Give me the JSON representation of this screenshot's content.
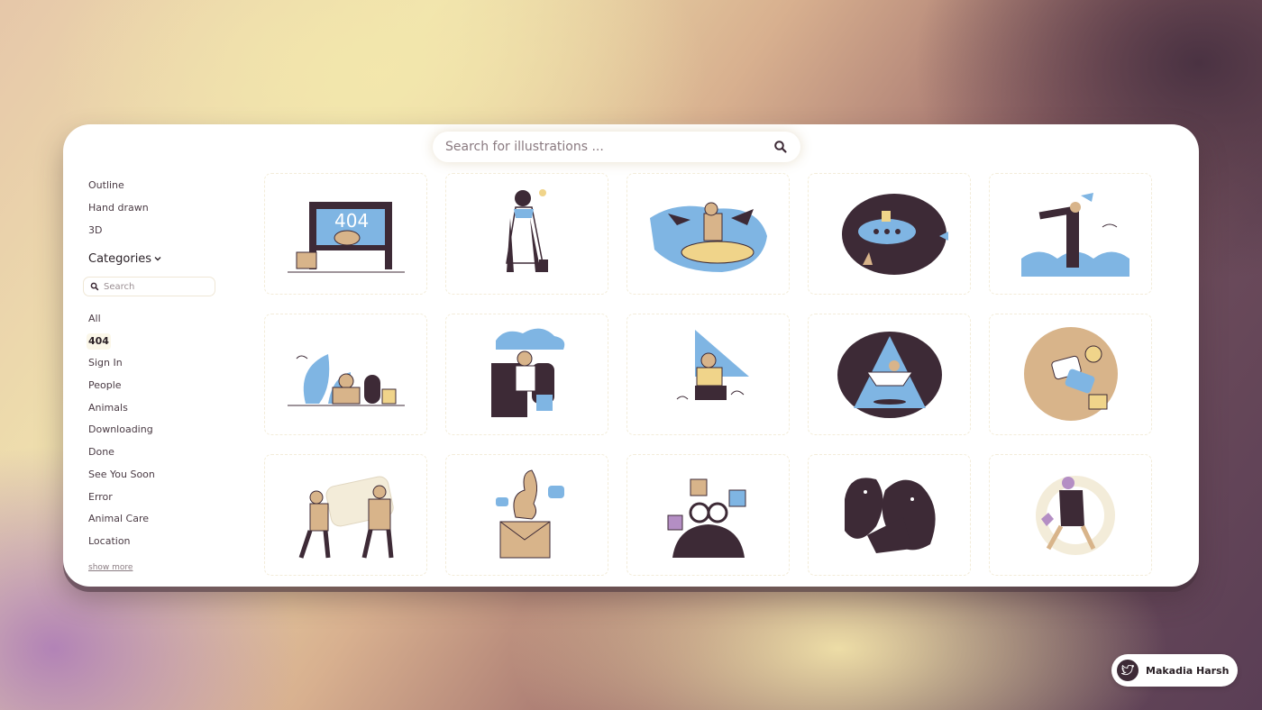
{
  "search": {
    "placeholder": "Search for illustrations ..."
  },
  "sidebar": {
    "styles": [
      "Outline",
      "Hand drawn",
      "3D"
    ],
    "categories_title": "Categories",
    "filter_placeholder": "Search",
    "categories": [
      "All",
      "404",
      "Sign In",
      "People",
      "Animals",
      "Downloading",
      "Done",
      "See You Soon",
      "Error",
      "Animal Care",
      "Location"
    ],
    "active_category": "404",
    "show_more": "show more"
  },
  "illustrations": [
    {
      "icon": "404-window-icon"
    },
    {
      "icon": "swing-person-icon"
    },
    {
      "icon": "surfer-icon"
    },
    {
      "icon": "submarine-icon"
    },
    {
      "icon": "telescope-lookout-icon"
    },
    {
      "icon": "plants-reading-icon"
    },
    {
      "icon": "armchair-cloud-icon"
    },
    {
      "icon": "triangle-explorer-icon"
    },
    {
      "icon": "paper-boat-icon"
    },
    {
      "icon": "space-portal-icon"
    },
    {
      "icon": "pushing-box-icon"
    },
    {
      "icon": "monster-mail-icon"
    },
    {
      "icon": "binoculars-icon"
    },
    {
      "icon": "dark-figures-icon"
    },
    {
      "icon": "floating-person-icon"
    }
  ],
  "colors": {
    "accent_dark": "#3d2a36",
    "blue": "#7fb5e3",
    "tan": "#d8b48a",
    "cream": "#fbf7e9"
  },
  "credit": {
    "name": "Makadia Harsh",
    "icon": "twitter-bird-icon"
  }
}
